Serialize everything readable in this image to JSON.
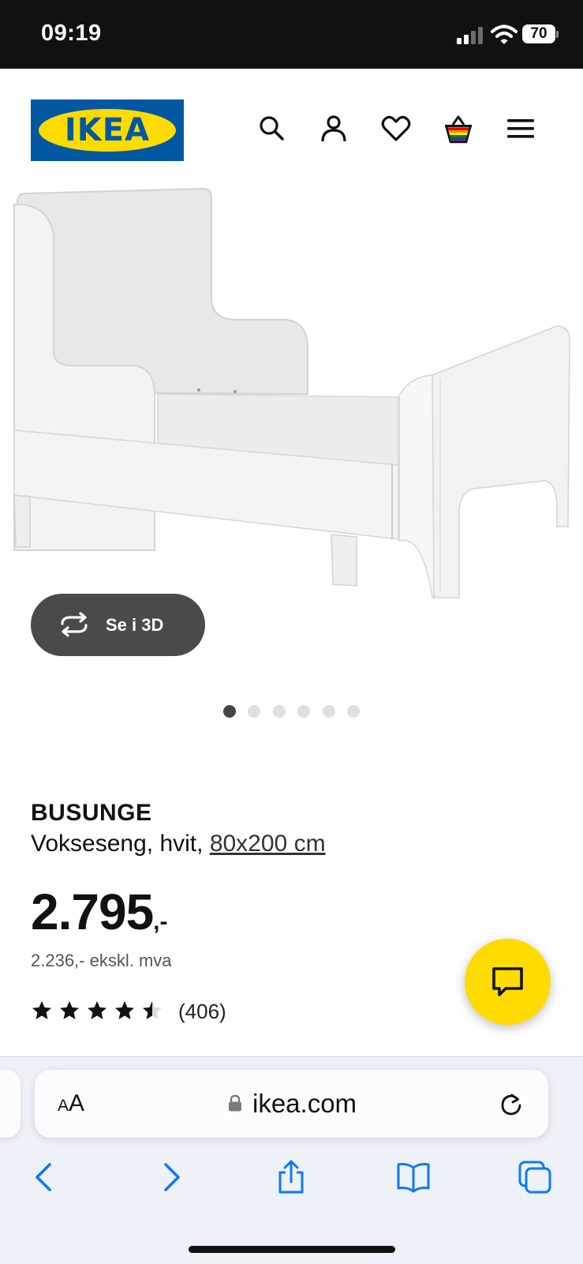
{
  "status_bar": {
    "time": "09:19",
    "battery": "70"
  },
  "header": {
    "logo_text": "IKEA",
    "icons": [
      "search-icon",
      "account-icon",
      "wishlist-heart-icon",
      "shopping-basket-icon",
      "menu-icon"
    ]
  },
  "gallery": {
    "view_3d_label": "Se i 3D",
    "image_count": 6,
    "active_index": 0
  },
  "product": {
    "name": "BUSUNGE",
    "description": "Vokseseng, hvit, ",
    "size": "80x200 cm",
    "price": "2.795",
    "price_suffix": ",-",
    "price_ex_vat": "2.236,- ekskl. mva",
    "rating_value": 4.5,
    "rating_max": 5,
    "review_count": "(406)"
  },
  "chat": {
    "icon": "chat-icon"
  },
  "browser": {
    "text_size_label": "AA",
    "domain": "ikea.com",
    "toolbar_icons": [
      "back-icon",
      "forward-icon",
      "share-icon",
      "bookmarks-icon",
      "tabs-icon"
    ]
  },
  "colors": {
    "ikea_blue": "#0058a3",
    "ikea_yellow": "#ffdb00",
    "status_bar": "#111111",
    "safari_blue": "#0a7aff"
  }
}
